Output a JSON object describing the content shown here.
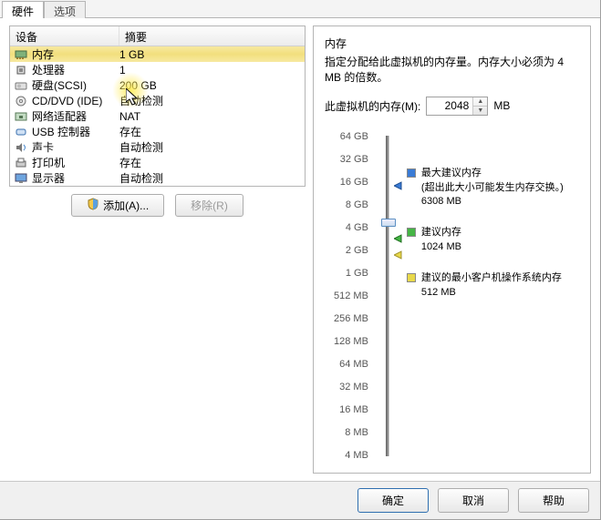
{
  "tabs": {
    "hardware": "硬件",
    "options": "选项"
  },
  "columns": {
    "device": "设备",
    "summary": "摘要"
  },
  "devices": [
    {
      "name": "内存",
      "summary": "1 GB",
      "icon": "memory-icon"
    },
    {
      "name": "处理器",
      "summary": "1",
      "icon": "cpu-icon"
    },
    {
      "name": "硬盘(SCSI)",
      "summary": "200 GB",
      "icon": "disk-icon"
    },
    {
      "name": "CD/DVD (IDE)",
      "summary": "自动检测",
      "icon": "cd-icon"
    },
    {
      "name": "网络适配器",
      "summary": "NAT",
      "icon": "nic-icon"
    },
    {
      "name": "USB 控制器",
      "summary": "存在",
      "icon": "usb-icon"
    },
    {
      "name": "声卡",
      "summary": "自动检测",
      "icon": "sound-icon"
    },
    {
      "name": "打印机",
      "summary": "存在",
      "icon": "printer-icon"
    },
    {
      "name": "显示器",
      "summary": "自动检测",
      "icon": "display-icon"
    }
  ],
  "left_buttons": {
    "add": "添加(A)...",
    "remove": "移除(R)"
  },
  "mem_panel": {
    "title": "内存",
    "desc": "指定分配给此虚拟机的内存量。内存大小必须为 4 MB 的倍数。",
    "field_label": "此虚拟机的内存(M):",
    "value": "2048",
    "unit": "MB"
  },
  "scale_labels": [
    "64 GB",
    "32 GB",
    "16 GB",
    "8 GB",
    "4 GB",
    "2 GB",
    "1 GB",
    "512 MB",
    "256 MB",
    "128 MB",
    "64 MB",
    "32 MB",
    "16 MB",
    "8 MB",
    "4 MB"
  ],
  "legend": {
    "max": {
      "title": "最大建议内存",
      "note": "(超出此大小可能发生内存交换。)",
      "val": "6308 MB"
    },
    "rec": {
      "title": "建议内存",
      "val": "1024 MB"
    },
    "min": {
      "title": "建议的最小客户机操作系统内存",
      "val": "512 MB"
    }
  },
  "footer": {
    "ok": "确定",
    "cancel": "取消",
    "help": "帮助"
  }
}
